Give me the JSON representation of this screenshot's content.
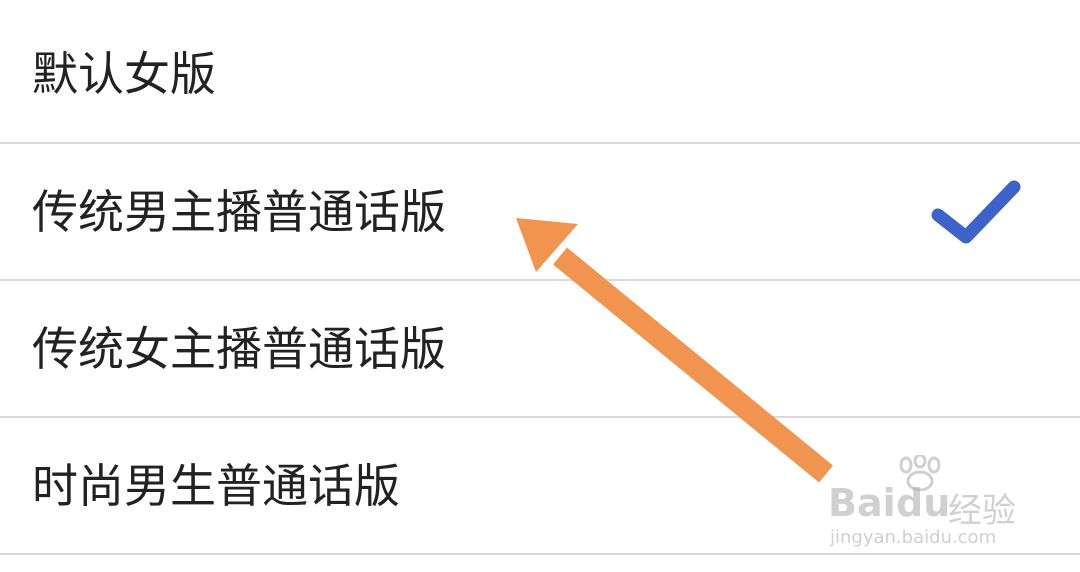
{
  "options": [
    {
      "label": "默认女版",
      "selected": false
    },
    {
      "label": "传统男主播普通话版",
      "selected": true
    },
    {
      "label": "传统女主播普通话版",
      "selected": false
    },
    {
      "label": "时尚男生普通话版",
      "selected": false
    }
  ],
  "colors": {
    "check": "#3d62c8",
    "arrow": "#f0944f",
    "divider": "#d9d9d9",
    "text": "#222222"
  },
  "icons": {
    "selected": "check-icon",
    "annotation": "arrow-annotation"
  },
  "watermark": {
    "brand_a": "Bai",
    "brand_b": "du",
    "brand_cn": "经验",
    "url": "jingyan.baidu.com"
  }
}
